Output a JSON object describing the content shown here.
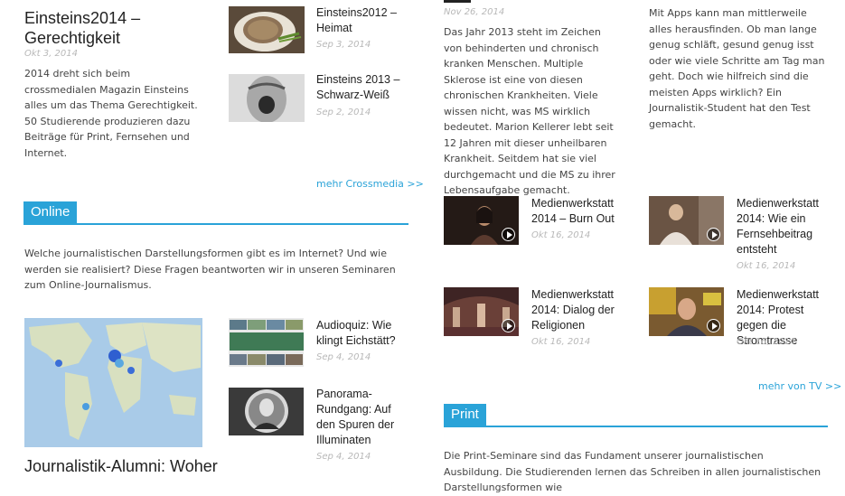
{
  "crossmedia": {
    "main_title": "Einsteins2014 – Gerechtigkeit",
    "main_date": "Okt 3, 2014",
    "main_text": "2014 dreht sich beim crossmedialen Magazin Einsteins alles um das Thema Gerechtigkeit. 50 Studierende produzieren dazu Beiträge für Print, Fernsehen und Internet.",
    "items": [
      {
        "title": "Einsteins2012 – Heimat",
        "date": "Sep 3, 2014",
        "icon": "bread-photo"
      },
      {
        "title": "Einsteins 2013 – Schwarz-Weiß",
        "date": "Sep 2, 2014",
        "icon": "screaming-face-photo"
      }
    ],
    "more": "mehr Crossmedia >>"
  },
  "online": {
    "heading": "Online",
    "intro": "Welche journalistischen Darstellungsformen gibt es im Internet? Und wie werden sie realisiert? Diese Fragen beantworten wir in unseren Seminaren zum Online-Journalismus.",
    "main_title": "Journalistik-Alumni: Woher",
    "items": [
      {
        "title": "Audioquiz: Wie klingt Eichstätt?",
        "date": "Sep 4, 2014",
        "icon": "photo-grid"
      },
      {
        "title": "Panorama-Rundgang: Auf den Spuren der Illuminaten",
        "date": "Sep 4, 2014",
        "icon": "portrait-photo"
      }
    ]
  },
  "tv": {
    "top_date": "Nov 26, 2014",
    "top_text": "Das Jahr 2013 steht im Zeichen von behinderten und chronisch kranken Menschen. Multiple Sklerose ist eine von diesen chronischen Krankheiten. Viele wissen nicht, was MS wirklich bedeutet. Marion Kellerer lebt seit 12 Jahren mit dieser unheilbaren Krankheit. Seitdem hat sie viel durchgemacht und die MS zu ihrer Lebensaufgabe gemacht.",
    "right_text": "Mit Apps kann man mittlerweile alles herausfinden. Ob man lange genug schläft, gesund genug isst oder wie viele Schritte am Tag man geht. Doch wie hilfreich sind die meisten Apps wirklich? Ein Journalistik-Student hat den Test gemacht.",
    "videos": [
      {
        "title": "Medienwerkstatt 2014 – Burn Out",
        "date": "Okt 16, 2014"
      },
      {
        "title": "Medienwerkstatt 2014: Wie ein Fernsehbeitrag entsteht",
        "date": "Okt 16, 2014"
      },
      {
        "title": "Medienwerkstatt 2014: Dialog der Religionen",
        "date": "Okt 16, 2014"
      },
      {
        "title": "Medienwerkstatt 2014: Protest gegen die Stromtrasse",
        "date": "Okt 16, 2014"
      }
    ],
    "more": "mehr von TV >>",
    "play_icon": "play-icon"
  },
  "print": {
    "heading": "Print",
    "intro": "Die Print-Seminare sind das Fundament unserer journalistischen Ausbildung. Die Studierenden lernen das Schreiben in allen journalistischen Darstellungsformen wie"
  },
  "colors": {
    "accent": "#2aa3d8",
    "date": "#b8b8b8"
  }
}
